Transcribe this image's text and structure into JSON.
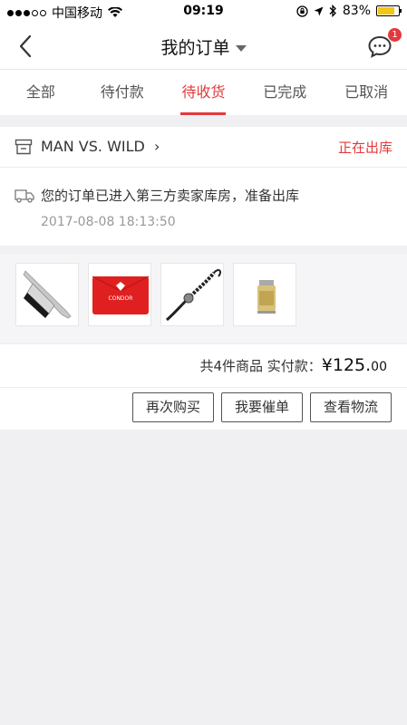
{
  "status_bar": {
    "carrier": "中国移动",
    "time": "09:19",
    "battery": "83%",
    "battery_level": 0.83
  },
  "nav": {
    "title": "我的订单",
    "message_badge": "1"
  },
  "tabs": [
    {
      "label": "全部",
      "active": false
    },
    {
      "label": "待付款",
      "active": false
    },
    {
      "label": "待收货",
      "active": true
    },
    {
      "label": "已完成",
      "active": false
    },
    {
      "label": "已取消",
      "active": false
    }
  ],
  "order": {
    "store_name": "MAN VS. WILD",
    "status": "正在出库",
    "logistics_message": "您的订单已进入第三方卖家库房，准备出库",
    "logistics_time": "2017-08-08 18:13:50",
    "products": [
      {
        "icon": "knife-product-image"
      },
      {
        "icon": "red-pouch-product-image",
        "brand_text": "CONDOR"
      },
      {
        "icon": "paracord-keychain-product-image"
      },
      {
        "icon": "lighter-product-image"
      }
    ],
    "summary_label": "共4件商品  实付款：",
    "price_yuan": "¥125.",
    "price_cents": "00"
  },
  "actions": {
    "rebuy": "再次购买",
    "urge": "我要催单",
    "logistics": "查看物流"
  },
  "colors": {
    "accent": "#e4393c",
    "background": "#f0f0f2"
  }
}
